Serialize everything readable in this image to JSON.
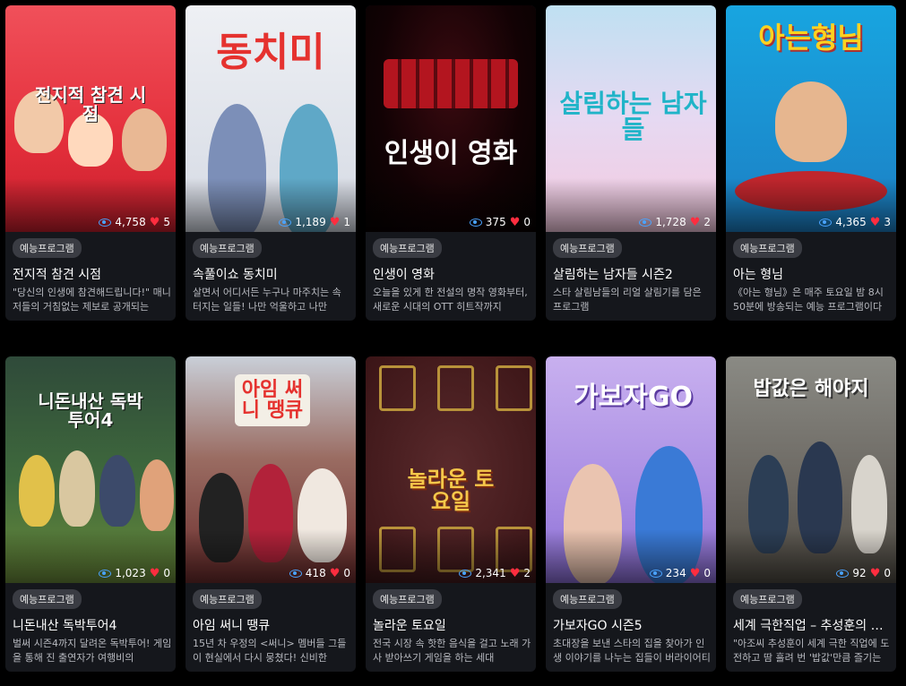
{
  "cards": [
    {
      "poster_text": "전지적 참견 시점",
      "category": "예능프로그램",
      "title": "전지적 참견 시점",
      "description": "\"당신의 인생에 참견해드립니다!\" 매니저들의 거침없는 제보로 공개되는",
      "views": "4,758",
      "likes": "5",
      "bg": "#e8323c"
    },
    {
      "poster_text": "동치미",
      "category": "예능프로그램",
      "title": "속풀이쇼 동치미",
      "description": "살면서 어디서든 누구나 마주치는 속 터지는 일들! 나만 억울하고 나만",
      "views": "1,189",
      "likes": "1",
      "bg": "#d9dde6"
    },
    {
      "poster_text": "인생이 영화",
      "category": "예능프로그램",
      "title": "인생이 영화",
      "description": "오늘을 있게 한 전설의 명작 영화부터, 새로운 시대의 OTT 히트작까지",
      "views": "375",
      "likes": "0",
      "bg": "#1a0306"
    },
    {
      "poster_text": "살림하는 남자들",
      "category": "예능프로그램",
      "title": "살림하는 남자들 시즌2",
      "description": "스타 살림남들의 리얼 살림기를 담은 프로그램",
      "views": "1,728",
      "likes": "2",
      "bg": "#c9e4f3"
    },
    {
      "poster_text": "아는형님",
      "category": "예능프로그램",
      "title": "아는 형님",
      "description": "《아는 형님》은 매주 토요일 밤 8시 50분에 방송되는 예능 프로그램이다",
      "views": "4,365",
      "likes": "3",
      "bg": "#1e9fd8"
    },
    {
      "poster_text": "니돈내산 독박투어4",
      "category": "예능프로그램",
      "title": "니돈내산 독박투어4",
      "description": "벌써 시즌4까지 달려온 독박투어! 게임을 통해 진 출연자가 여행비의",
      "views": "1,023",
      "likes": "0",
      "bg": "#3b5a3a"
    },
    {
      "poster_text": "아임 써니 땡큐",
      "category": "예능프로그램",
      "title": "아임 써니 땡큐",
      "description": "15년 차 우정의 <써니> 멤버들 그들이 현실에서 다시 뭉쳤다! 신비한",
      "views": "418",
      "likes": "0",
      "bg": "#6f3a34"
    },
    {
      "poster_text": "놀라운 토요일",
      "category": "예능프로그램",
      "title": "놀라운 토요일",
      "description": "전국 시장 속 핫한 음식을 걸고 노래 가사 받아쓰기 게임을 하는 세대",
      "views": "2,341",
      "likes": "2",
      "bg": "#4a1f22"
    },
    {
      "poster_text": "가보자GO",
      "category": "예능프로그램",
      "title": "가보자GO 시즌5",
      "description": "초대장을 보낸 스타의 집을 찾아가 인생 이야기를 나누는 집들이 버라이어티",
      "views": "234",
      "likes": "0",
      "bg": "#b99be8"
    },
    {
      "poster_text": "밥값은 해야지",
      "category": "예능프로그램",
      "title": "세계 극한직업 – 추성훈의 밥값은 해야지",
      "description": "\"아조씨 추성훈이 세계 극한 직업에 도전하고 땀 흘려 번 '밥값'만큼 즐기는",
      "views": "92",
      "likes": "0",
      "bg": "#6c6a62"
    }
  ]
}
